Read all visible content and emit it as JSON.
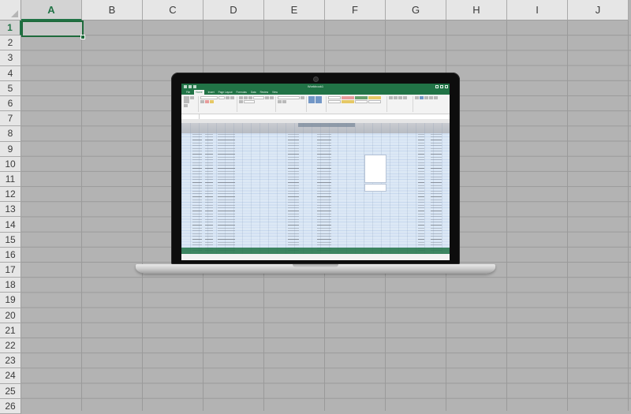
{
  "spreadsheet": {
    "columns": [
      "A",
      "B",
      "C",
      "D",
      "E",
      "F",
      "G",
      "H",
      "I",
      "J"
    ],
    "rows": [
      "1",
      "2",
      "3",
      "4",
      "5",
      "6",
      "7",
      "8",
      "9",
      "10",
      "11",
      "12",
      "13",
      "14",
      "15",
      "16",
      "17",
      "18",
      "19",
      "20",
      "21",
      "22",
      "23",
      "24",
      "25",
      "26"
    ],
    "active_cell": {
      "column": "A",
      "row": "1"
    }
  },
  "laptop_screen": {
    "window_title": "Workbook1",
    "ribbon_tabs": [
      "File",
      "Home",
      "Insert",
      "Page Layout",
      "Formulas",
      "Data",
      "Review",
      "View"
    ],
    "active_tab": "Home"
  },
  "colors": {
    "sheet_background": "#b3b3b3",
    "header_background": "#e6e6e6",
    "selection": "#1f6b3c",
    "excel_green": "#217346",
    "row_band_blue": "#dce8f5"
  }
}
